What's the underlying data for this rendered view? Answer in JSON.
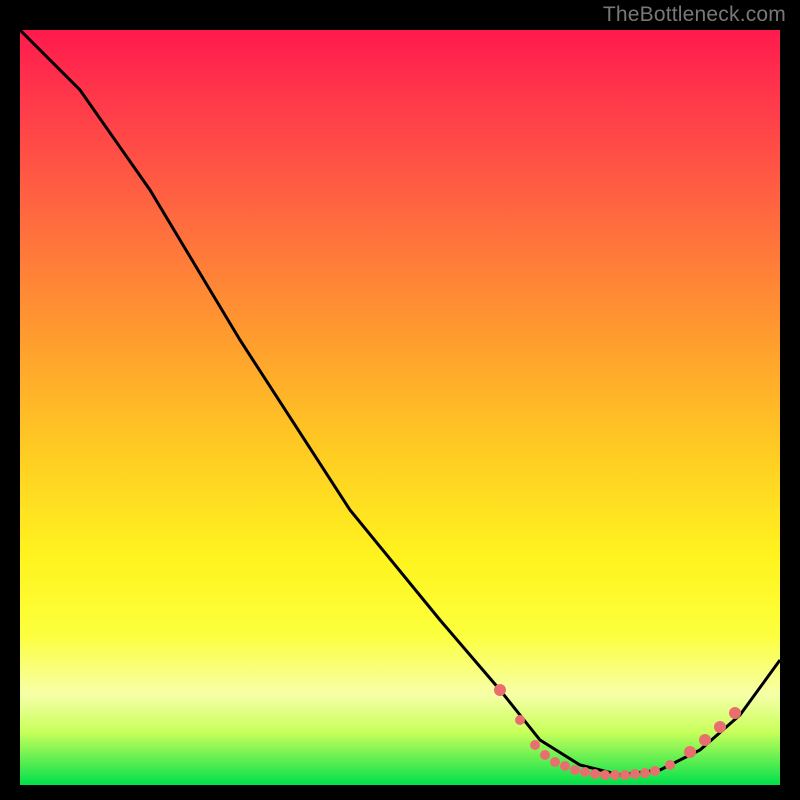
{
  "watermark": "TheBottleneck.com",
  "chart_data": {
    "type": "line",
    "title": "",
    "xlabel": "",
    "ylabel": "",
    "xlim": [
      0,
      100
    ],
    "ylim": [
      0,
      100
    ],
    "grid": false,
    "legend": false,
    "series": [
      {
        "name": "curve",
        "x": [
          0,
          8,
          20,
          35,
          50,
          60,
          65,
          70,
          75,
          80,
          85,
          90,
          95,
          100
        ],
        "y": [
          100,
          92,
          76,
          55,
          34,
          20,
          12,
          4,
          1,
          0.5,
          1,
          4,
          10,
          18
        ]
      }
    ],
    "markers": {
      "name": "dots",
      "x": [
        65,
        67,
        69,
        71,
        72,
        73,
        75,
        77,
        78,
        80,
        82,
        84,
        87,
        89,
        91,
        93,
        95
      ],
      "y": [
        12,
        8,
        5,
        3,
        2.5,
        2,
        1.5,
        1,
        1,
        0.7,
        0.8,
        1,
        2,
        3,
        5,
        7,
        10
      ]
    },
    "background_gradient": {
      "direction": "vertical",
      "stops": [
        {
          "pos": 0.0,
          "color": "#ff1a4d"
        },
        {
          "pos": 0.5,
          "color": "#ffd028"
        },
        {
          "pos": 0.8,
          "color": "#fff820"
        },
        {
          "pos": 1.0,
          "color": "#00e04a"
        }
      ]
    }
  }
}
